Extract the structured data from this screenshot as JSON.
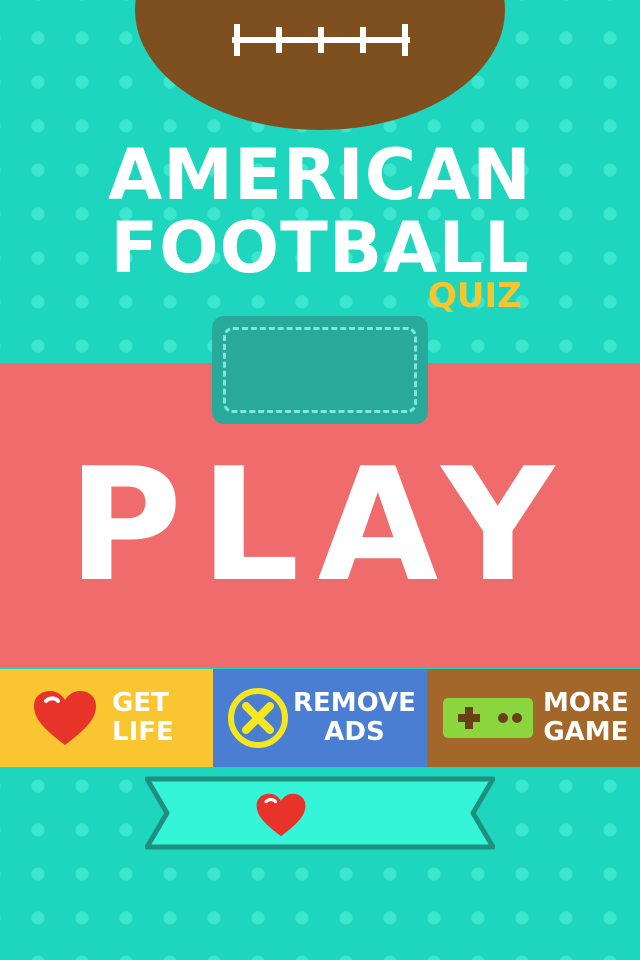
{
  "title": {
    "line1": "AMERICAN",
    "line2": "FOOTBALL",
    "sub": "QUIZ"
  },
  "play": {
    "label": "PLAY"
  },
  "buttons": [
    {
      "line1": "GET",
      "line2": "LIFE",
      "icon": "heart-icon",
      "color": "#f9c530"
    },
    {
      "line1": "REMOVE",
      "line2": "ADS",
      "icon": "x-circle-icon",
      "color": "#4a7ed2"
    },
    {
      "line1": "MORE",
      "line2": "GAME",
      "icon": "gamepad-icon",
      "color": "#a4672a"
    }
  ],
  "lives_ribbon": {
    "icon": "heart-icon"
  },
  "colors": {
    "background": "#1ed6bd",
    "play_band": "#f06b6b",
    "football": "#7e5020",
    "quiz": "#f7c52d"
  }
}
